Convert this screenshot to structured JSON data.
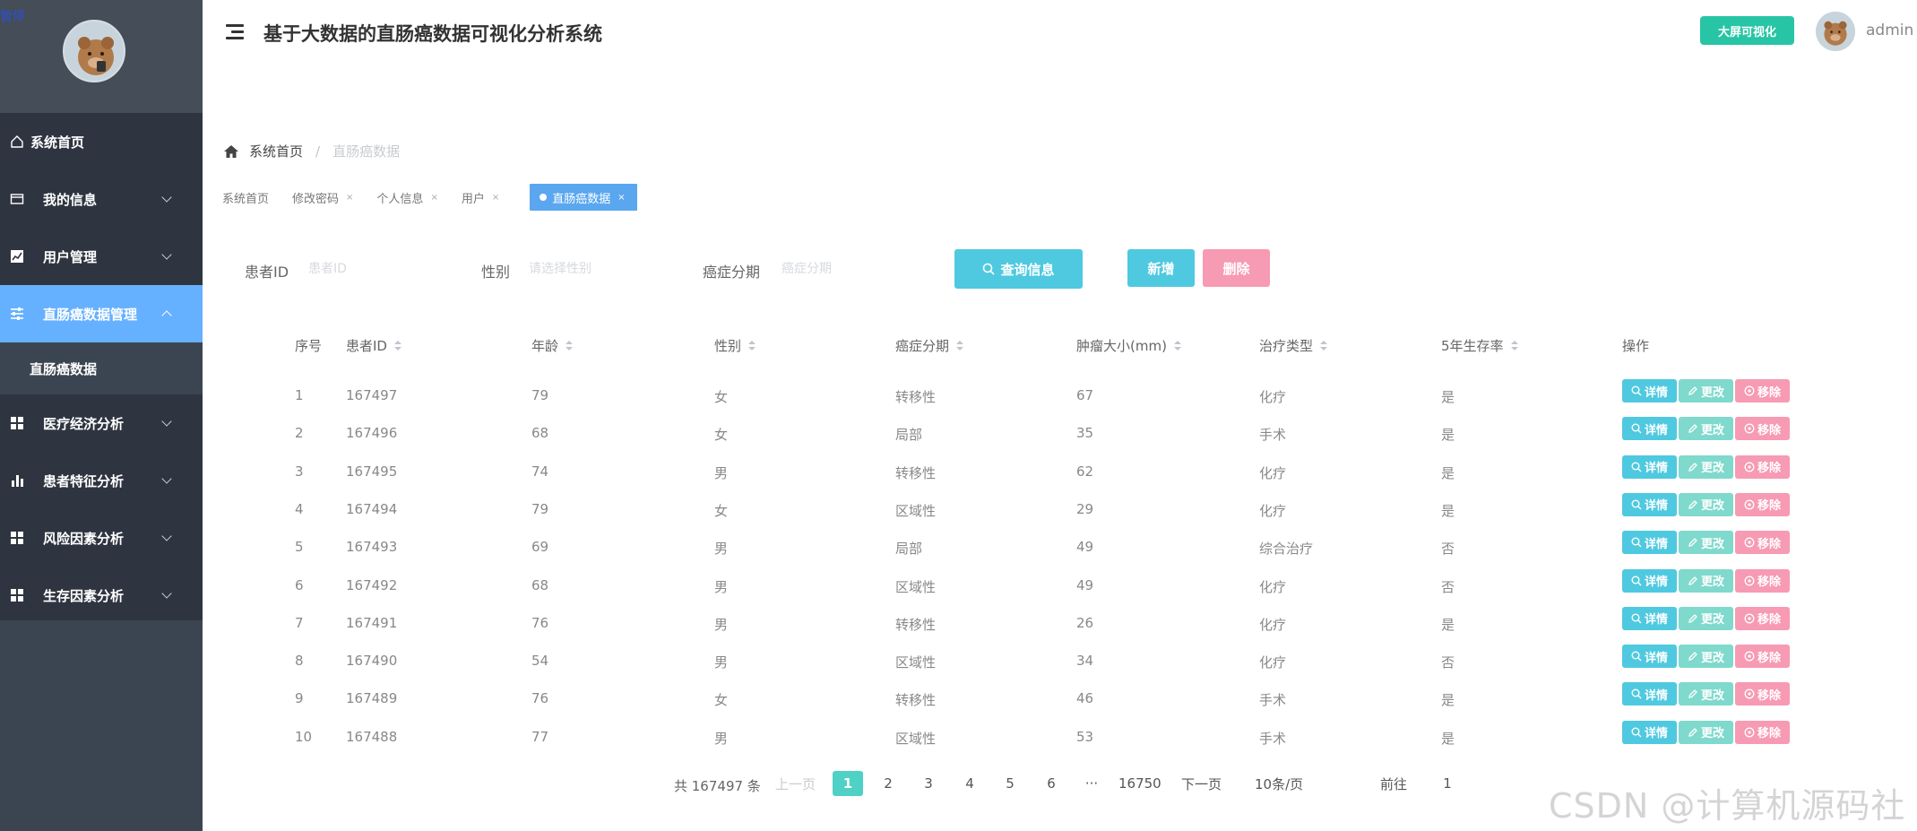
{
  "app": {
    "title": "基于大数据的直肠癌数据可视化分析系统",
    "sidebar_badge": "暂停",
    "big_screen_label": "大屏可视化",
    "username": "admin"
  },
  "sidebar": {
    "items": [
      {
        "label": "系统首页",
        "icon": "home-icon"
      },
      {
        "label": "我的信息",
        "icon": "card-icon"
      },
      {
        "label": "用户管理",
        "icon": "chart-icon"
      },
      {
        "label": "直肠癌数据管理",
        "icon": "sliders-icon"
      },
      {
        "label": "医疗经济分析",
        "icon": "grid-icon"
      },
      {
        "label": "患者特征分析",
        "icon": "bar-icon"
      },
      {
        "label": "风险因素分析",
        "icon": "grid-icon"
      },
      {
        "label": "生存因素分析",
        "icon": "grid-icon"
      }
    ],
    "submenu": "直肠癌数据"
  },
  "breadcrumb": {
    "home": "系统首页",
    "current": "直肠癌数据"
  },
  "tags": [
    "系统首页",
    "修改密码",
    "个人信息",
    "用户",
    "直肠癌数据"
  ],
  "search": {
    "patient_id_label": "患者ID",
    "patient_id_placeholder": "患者ID",
    "gender_label": "性别",
    "gender_placeholder": "请选择性别",
    "stage_label": "癌症分期",
    "stage_placeholder": "癌症分期",
    "query_label": "查询信息",
    "add_label": "新增",
    "delete_label": "删除"
  },
  "table": {
    "headers": [
      "序号",
      "患者ID",
      "年龄",
      "性别",
      "癌症分期",
      "肿瘤大小(mm)",
      "治疗类型",
      "5年生存率",
      "操作"
    ],
    "rows": [
      [
        "1",
        "167497",
        "79",
        "女",
        "转移性",
        "67",
        "化疗",
        "是"
      ],
      [
        "2",
        "167496",
        "68",
        "女",
        "局部",
        "35",
        "手术",
        "是"
      ],
      [
        "3",
        "167495",
        "74",
        "男",
        "转移性",
        "62",
        "化疗",
        "是"
      ],
      [
        "4",
        "167494",
        "79",
        "女",
        "区域性",
        "29",
        "化疗",
        "是"
      ],
      [
        "5",
        "167493",
        "69",
        "男",
        "局部",
        "49",
        "综合治疗",
        "否"
      ],
      [
        "6",
        "167492",
        "68",
        "男",
        "区域性",
        "49",
        "化疗",
        "否"
      ],
      [
        "7",
        "167491",
        "76",
        "男",
        "转移性",
        "26",
        "化疗",
        "是"
      ],
      [
        "8",
        "167490",
        "54",
        "男",
        "区域性",
        "34",
        "化疗",
        "否"
      ],
      [
        "9",
        "167489",
        "76",
        "女",
        "转移性",
        "46",
        "手术",
        "是"
      ],
      [
        "10",
        "167488",
        "77",
        "男",
        "区域性",
        "53",
        "手术",
        "是"
      ]
    ],
    "actions": {
      "detail": "详情",
      "edit": "更改",
      "remove": "移除"
    }
  },
  "pagination": {
    "total": "共 167497 条",
    "prev": "上一页",
    "pages": [
      "1",
      "2",
      "3",
      "4",
      "5",
      "6"
    ],
    "ellipsis": "···",
    "last": "16750",
    "next": "下一页",
    "page_size": "10条/页",
    "goto_label": "前往",
    "goto_value": "1"
  },
  "watermark": "CSDN @计算机源码社",
  "colors": {
    "accent": "#66b1ff",
    "teal": "#4fc9e0",
    "pink": "#f79ab3",
    "green": "#27c5a5",
    "sidebar": "#2f3540"
  }
}
